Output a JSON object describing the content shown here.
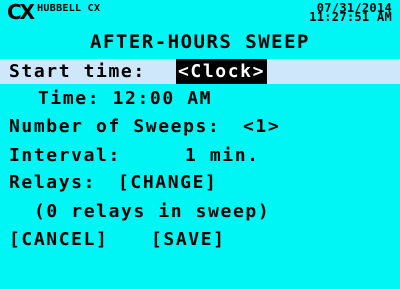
{
  "header": {
    "logo": "CX",
    "product": "HUBBELL CX",
    "date": "07/31/2014",
    "time": "11:27:51 AM"
  },
  "title": "AFTER-HOURS SWEEP",
  "start_time": {
    "label": "Start time: ",
    "value": "<Clock>"
  },
  "time_row": {
    "label": "Time: 12:00 AM"
  },
  "sweeps": {
    "label": "Number of Sweeps: ",
    "value": "<1>"
  },
  "interval": {
    "label": "Interval:",
    "value": "1 min."
  },
  "relays": {
    "label": "Relays: ",
    "change": "[CHANGE]",
    "count": "(0 relays in sweep)"
  },
  "actions": {
    "cancel": "[CANCEL]",
    "save": "[SAVE]"
  },
  "colors": {
    "background": "#00f6f4",
    "selected_row": "#cfe7fa",
    "text": "#000000"
  }
}
